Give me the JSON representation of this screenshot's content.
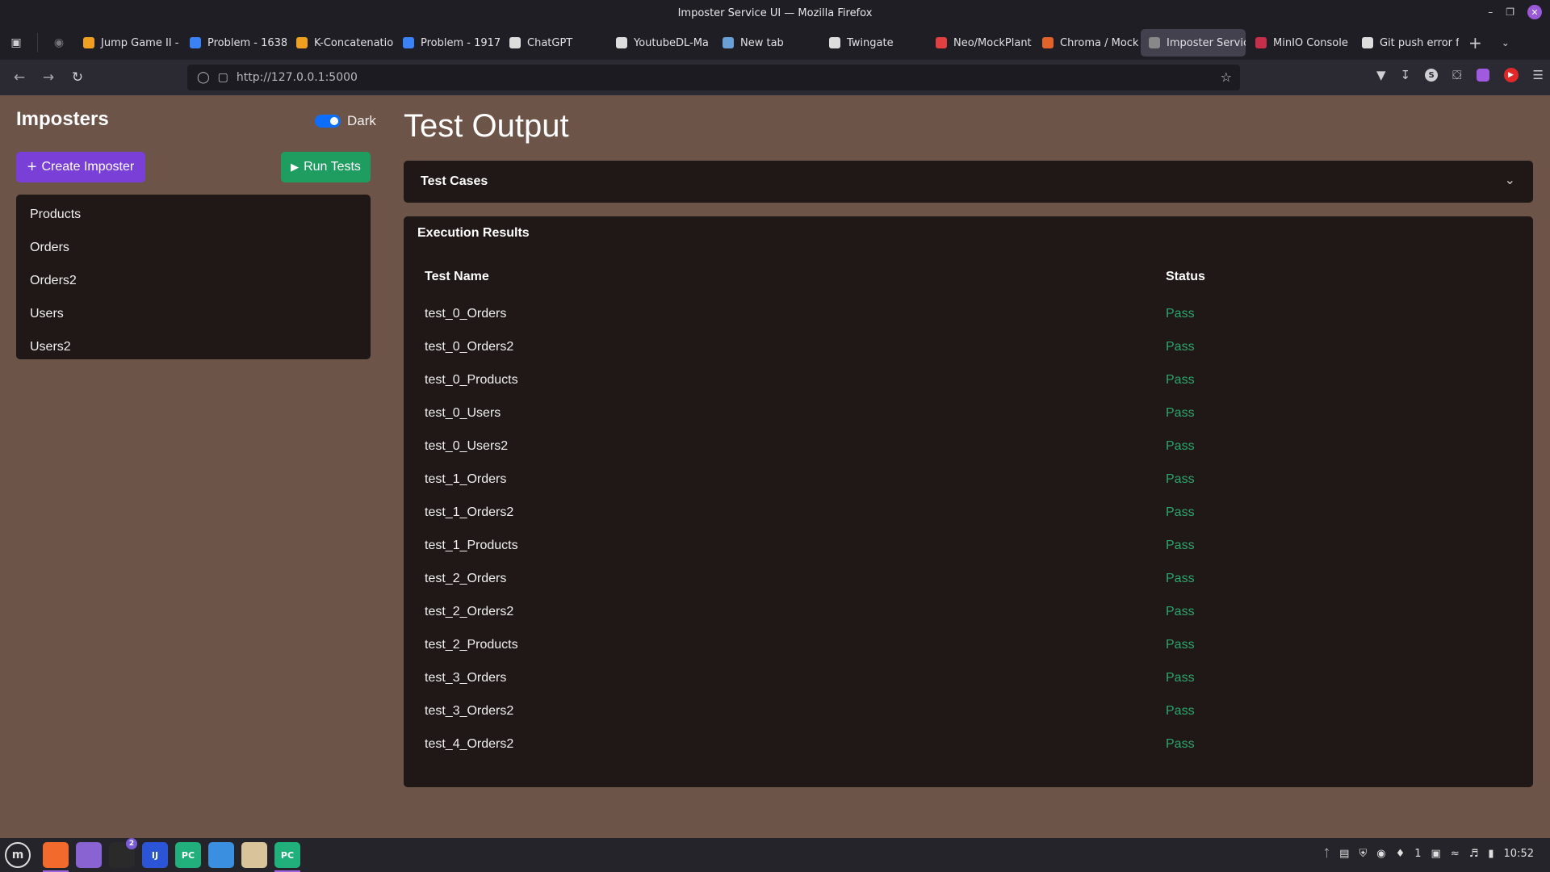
{
  "window": {
    "title": "Imposter Service UI — Mozilla Firefox"
  },
  "tabs": [
    {
      "label": "Jump Game II -",
      "icon": "leetcode-icon",
      "color": "#f0a020"
    },
    {
      "label": "Problem - 1638",
      "icon": "codeforces-icon",
      "color": "#3b82f6"
    },
    {
      "label": "K-Concatenatio",
      "icon": "leetcode-icon",
      "color": "#f0a020"
    },
    {
      "label": "Problem - 1917",
      "icon": "codeforces-icon",
      "color": "#3b82f6"
    },
    {
      "label": "ChatGPT",
      "icon": "chatgpt-icon",
      "color": "#dddddd"
    },
    {
      "label": "YoutubeDL-Ma",
      "icon": "github-icon",
      "color": "#dddddd"
    },
    {
      "label": "New tab",
      "icon": "newtab-icon",
      "color": "#6aa0d8"
    },
    {
      "label": "Twingate",
      "icon": "twingate-icon",
      "color": "#dddddd"
    },
    {
      "label": "Neo/MockPlant",
      "icon": "mockplant-icon",
      "color": "#e04040"
    },
    {
      "label": "Chroma / Mock",
      "icon": "gitlab-icon",
      "color": "#e2622c"
    },
    {
      "label": "Imposter Service",
      "icon": "page-icon",
      "color": "#888888",
      "active": true
    },
    {
      "label": "MinIO Console",
      "icon": "minio-icon",
      "color": "#c72e49"
    },
    {
      "label": "Git push error f",
      "icon": "chatgpt-icon",
      "color": "#dddddd"
    }
  ],
  "navbar": {
    "url": "http://127.0.0.1:5000"
  },
  "sidebar": {
    "title": "Imposters",
    "theme_toggle_label": "Dark",
    "create_button": "Create Imposter",
    "run_button": "Run Tests",
    "items": [
      "Products",
      "Orders",
      "Orders2",
      "Users",
      "Users2"
    ]
  },
  "main": {
    "title": "Test Output",
    "accordion_label": "Test Cases",
    "results_title": "Execution Results",
    "columns": [
      "Test Name",
      "Status"
    ],
    "rows": [
      {
        "name": "test_0_Orders",
        "status": "Pass"
      },
      {
        "name": "test_0_Orders2",
        "status": "Pass"
      },
      {
        "name": "test_0_Products",
        "status": "Pass"
      },
      {
        "name": "test_0_Users",
        "status": "Pass"
      },
      {
        "name": "test_0_Users2",
        "status": "Pass"
      },
      {
        "name": "test_1_Orders",
        "status": "Pass"
      },
      {
        "name": "test_1_Orders2",
        "status": "Pass"
      },
      {
        "name": "test_1_Products",
        "status": "Pass"
      },
      {
        "name": "test_2_Orders",
        "status": "Pass"
      },
      {
        "name": "test_2_Orders2",
        "status": "Pass"
      },
      {
        "name": "test_2_Products",
        "status": "Pass"
      },
      {
        "name": "test_3_Orders",
        "status": "Pass"
      },
      {
        "name": "test_3_Orders2",
        "status": "Pass"
      },
      {
        "name": "test_4_Orders2",
        "status": "Pass"
      }
    ]
  },
  "taskbar": {
    "apps": [
      {
        "icon": "firefox-icon",
        "color": "#f36b2c",
        "active": true
      },
      {
        "icon": "files-icon",
        "color": "#8a63d2"
      },
      {
        "icon": "terminal-icon",
        "color": "#2a2a2a",
        "badge": "2"
      },
      {
        "icon": "intellij-icon",
        "color": "#2b55d6",
        "label": "IJ"
      },
      {
        "icon": "pycharm-icon",
        "color": "#21b07c",
        "label": "PC"
      },
      {
        "icon": "vscode-icon",
        "color": "#3a8fe0"
      },
      {
        "icon": "archive-icon",
        "color": "#d9c39a"
      },
      {
        "icon": "pycharm-icon",
        "color": "#21b07c",
        "label": "PC",
        "active": true
      }
    ],
    "workspace": "1",
    "clock": "10:52"
  },
  "colors": {
    "page_bg": "#6d5448",
    "card_bg": "#1f1816",
    "pass": "#2ea56c",
    "create_button": "#7a3fd6",
    "run_button": "#1f9d60",
    "toggle": "#0d6efd"
  }
}
